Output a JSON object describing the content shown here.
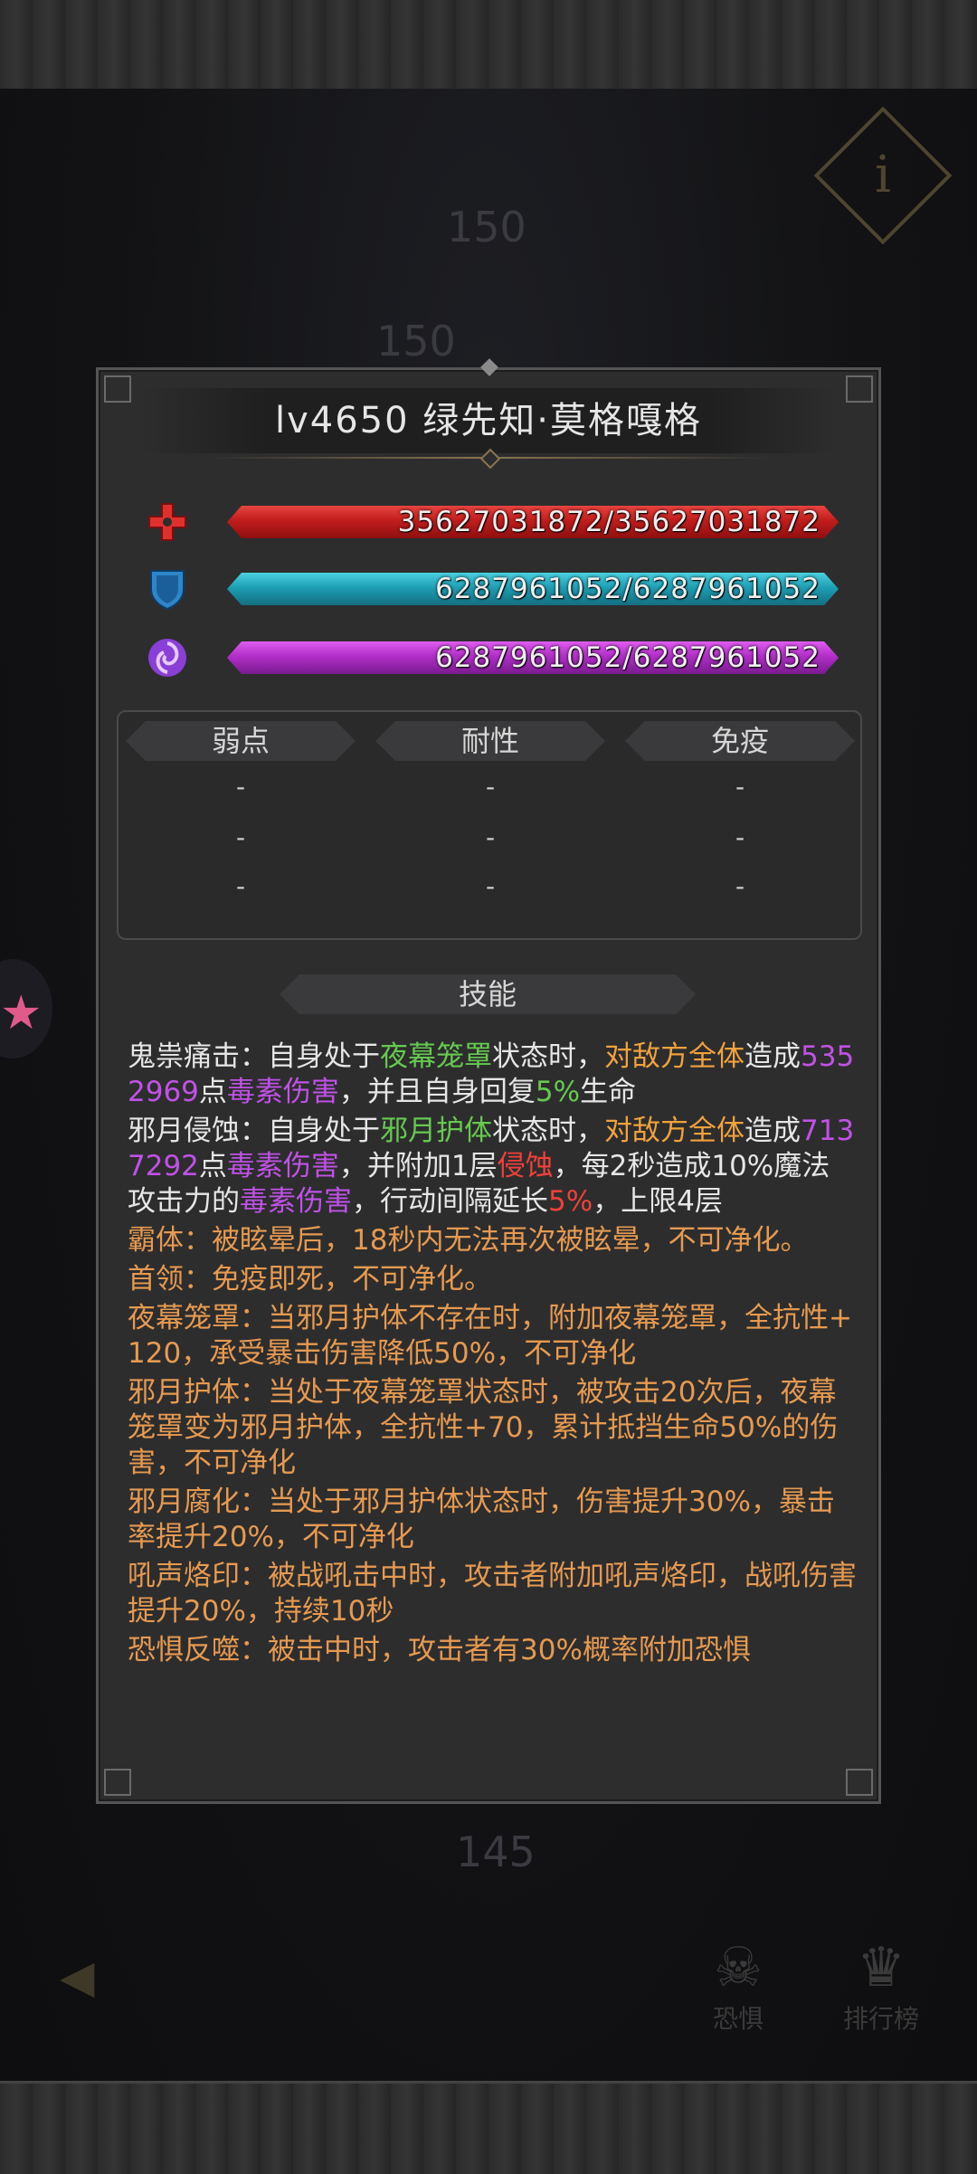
{
  "background": {
    "nums": [
      "150",
      "150",
      "145"
    ],
    "info_glyph": "i",
    "btn_left": "恐惧",
    "btn_right": "排行榜"
  },
  "boss": {
    "title": "lv4650  绿先知·莫格嘎格",
    "hp": "35627031872/35627031872",
    "shield": "6287961052/6287961052",
    "mana": "6287961052/6287961052",
    "hp_fraction": 1.0,
    "shield_fraction": 1.0,
    "mana_fraction": 1.0,
    "colors": {
      "hp": "#c11d1d",
      "shield": "#1e9fb4",
      "mana": "#b12fc8"
    },
    "icons": {
      "hp": "red-cross-icon",
      "shield": "shield-icon",
      "mana": "swirl-icon"
    }
  },
  "resist": {
    "headers": [
      "弱点",
      "耐性",
      "免疫"
    ],
    "rows": [
      [
        "-",
        "-",
        "-"
      ],
      [
        "-",
        "-",
        "-"
      ],
      [
        "-",
        "-",
        "-"
      ]
    ]
  },
  "skills_header": "技能",
  "skills": {
    "s1": {
      "a": "鬼祟痛击：自身处于",
      "b": "夜幕笼罩",
      "c": "状态时，",
      "d": "对敌方全体",
      "e": "造成",
      "f": "5352969",
      "g": "点",
      "h": "毒素伤害",
      "i": "，并且自身回复",
      "j": "5%",
      "k": "生命"
    },
    "s2": {
      "a": "邪月侵蚀：自身处于",
      "b": "邪月护体",
      "c": "状态时，",
      "d": "对敌方全体",
      "e": "造成",
      "f": "7137292",
      "g": "点",
      "h": "毒素伤害",
      "i": "，并附加1层",
      "j": "侵蚀",
      "k": "，每2秒造成10%魔法攻击力的",
      "l": "毒素伤害",
      "m": "，行动间隔延长",
      "n": "5%",
      "o": "，上限4层"
    },
    "s3": "霸体：被眩晕后，18秒内无法再次被眩晕，不可净化。",
    "s4": "首领：免疫即死，不可净化。",
    "s5": "夜幕笼罩：当邪月护体不存在时，附加夜幕笼罩，全抗性+120，承受暴击伤害降低50%，不可净化",
    "s6": "邪月护体：当处于夜幕笼罩状态时，被攻击20次后，夜幕笼罩变为邪月护体，全抗性+70，累计抵挡生命50%的伤害，不可净化",
    "s7": "邪月腐化：当处于邪月护体状态时，伤害提升30%，暴击率提升20%，不可净化",
    "s8": "吼声烙印：被战吼击中时，攻击者附加吼声烙印，战吼伤害提升20%，持续10秒",
    "s9": "恐惧反噬：被击中时，攻击者有30%概率附加恐惧"
  }
}
